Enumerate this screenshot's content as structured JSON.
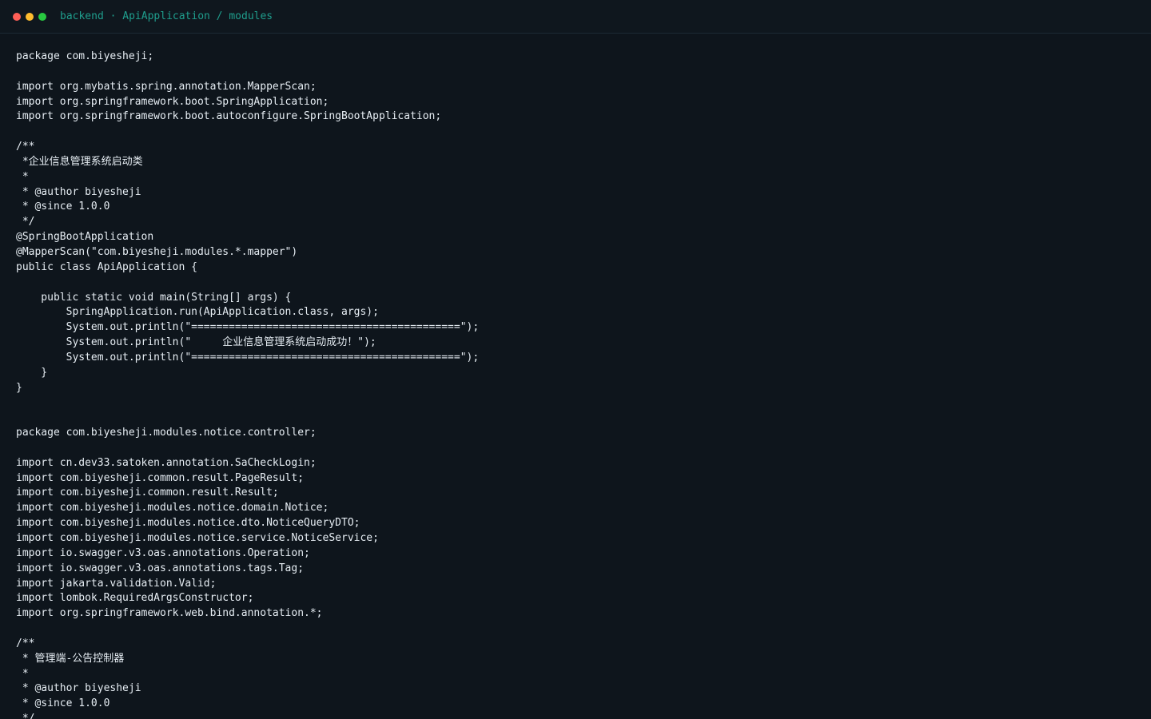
{
  "window": {
    "title_project": "backend",
    "title_separator": " · ",
    "title_path": "ApiApplication / modules",
    "controls": {
      "close_color": "#ff5f57",
      "minimize_color": "#febc2e",
      "maximize_color": "#28c840"
    }
  },
  "colors": {
    "background": "#0e151c",
    "text": "#e6edf3",
    "accent": "#1f9e8d"
  },
  "code_lines": [
    "package com.biyesheji;",
    "",
    "import org.mybatis.spring.annotation.MapperScan;",
    "import org.springframework.boot.SpringApplication;",
    "import org.springframework.boot.autoconfigure.SpringBootApplication;",
    "",
    "/**",
    " *企业信息管理系统启动类",
    " *",
    " * @author biyesheji",
    " * @since 1.0.0",
    " */",
    "@SpringBootApplication",
    "@MapperScan(\"com.biyesheji.modules.*.mapper\")",
    "public class ApiApplication {",
    "",
    "    public static void main(String[] args) {",
    "        SpringApplication.run(ApiApplication.class, args);",
    "        System.out.println(\"===========================================\");",
    "        System.out.println(\"     企业信息管理系统启动成功！\");",
    "        System.out.println(\"===========================================\");",
    "    }",
    "}",
    "",
    "",
    "package com.biyesheji.modules.notice.controller;",
    "",
    "import cn.dev33.satoken.annotation.SaCheckLogin;",
    "import com.biyesheji.common.result.PageResult;",
    "import com.biyesheji.common.result.Result;",
    "import com.biyesheji.modules.notice.domain.Notice;",
    "import com.biyesheji.modules.notice.dto.NoticeQueryDTO;",
    "import com.biyesheji.modules.notice.service.NoticeService;",
    "import io.swagger.v3.oas.annotations.Operation;",
    "import io.swagger.v3.oas.annotations.tags.Tag;",
    "import jakarta.validation.Valid;",
    "import lombok.RequiredArgsConstructor;",
    "import org.springframework.web.bind.annotation.*;",
    "",
    "/**",
    " * 管理端-公告控制器",
    " *",
    " * @author biyesheji",
    " * @since 1.0.0",
    " */"
  ]
}
